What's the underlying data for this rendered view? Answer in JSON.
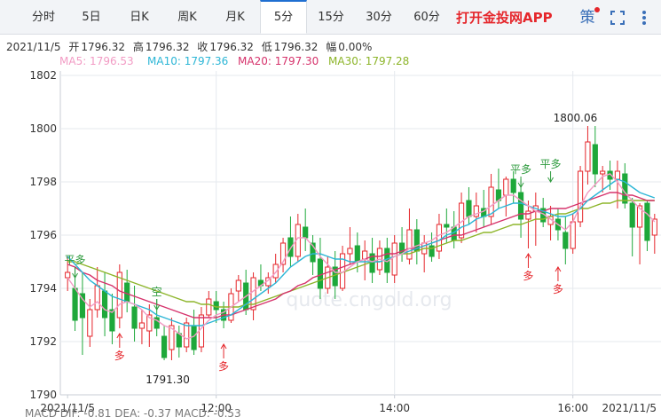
{
  "tabs": [
    {
      "label": "分时"
    },
    {
      "label": "5日"
    },
    {
      "label": "日K"
    },
    {
      "label": "周K"
    },
    {
      "label": "月K"
    },
    {
      "label": "5分",
      "active": true
    },
    {
      "label": "15分"
    },
    {
      "label": "30分"
    },
    {
      "label": "60分"
    }
  ],
  "app_link": "打开金投网APP",
  "tools": {
    "strategy": "策",
    "fullscreen_icon": "fullscreen-icon",
    "more_icon": "more-dots-icon"
  },
  "quote": {
    "date": "2021/11/5",
    "open_label": "开",
    "open": "1796.32",
    "high_label": "高",
    "high": "1796.32",
    "close_label": "收",
    "close": "1796.32",
    "low_label": "低",
    "low": "1796.32",
    "amp_label": "幅",
    "amp": "0.00%"
  },
  "ma_legend": [
    {
      "label": "MA5: 1796.53",
      "color": "#f29bc4"
    },
    {
      "label": "MA10: 1797.36",
      "color": "#2cb6d6"
    },
    {
      "label": "MA20: 1797.30",
      "color": "#d6336c"
    },
    {
      "label": "MA30: 1797.28",
      "color": "#8db52a"
    }
  ],
  "macd_legend": {
    "text": "MACD  DIF: -0.81    DEA: -0.37    MACD: -0.53"
  },
  "watermark": "quote.cngold.org",
  "colors": {
    "up": "#e5262b",
    "down": "#1ea83a",
    "grid": "#e6e9ee",
    "axis_text": "#333333",
    "signal": "#e5262b",
    "signal_flat": "#2e9b3e"
  },
  "chart_data": {
    "type": "candlestick",
    "instrument_interval": "5分",
    "ylim": [
      1790,
      1802
    ],
    "y_ticks": [
      "1790",
      "1792",
      "1794",
      "1796",
      "1798",
      "1800",
      "1802"
    ],
    "x_ticks": [
      {
        "label": "2021/11/5",
        "index": 0
      },
      {
        "label": "12:00",
        "index": 20
      },
      {
        "label": "14:00",
        "index": 44
      },
      {
        "label": "16:00",
        "index": 68
      },
      {
        "label": "2021/11/5",
        "index": 80
      }
    ],
    "candles": [
      {
        "o": 1794.4,
        "h": 1795.2,
        "l": 1793.9,
        "c": 1794.6
      },
      {
        "o": 1794.0,
        "h": 1794.8,
        "l": 1792.4,
        "c": 1792.8
      },
      {
        "o": 1793.8,
        "h": 1794.6,
        "l": 1791.5,
        "c": 1792.9
      },
      {
        "o": 1792.2,
        "h": 1793.6,
        "l": 1791.8,
        "c": 1793.2
      },
      {
        "o": 1793.2,
        "h": 1794.8,
        "l": 1792.9,
        "c": 1794.1
      },
      {
        "o": 1793.9,
        "h": 1794.6,
        "l": 1792.2,
        "c": 1792.9
      },
      {
        "o": 1793.2,
        "h": 1793.8,
        "l": 1791.9,
        "c": 1792.4
      },
      {
        "o": 1792.9,
        "h": 1794.9,
        "l": 1792.5,
        "c": 1794.6
      },
      {
        "o": 1794.2,
        "h": 1794.7,
        "l": 1793.1,
        "c": 1793.5
      },
      {
        "o": 1793.3,
        "h": 1794.1,
        "l": 1792.0,
        "c": 1792.5
      },
      {
        "o": 1792.5,
        "h": 1793.2,
        "l": 1791.9,
        "c": 1792.7
      },
      {
        "o": 1792.4,
        "h": 1793.4,
        "l": 1791.8,
        "c": 1793.0
      },
      {
        "o": 1792.9,
        "h": 1793.6,
        "l": 1792.2,
        "c": 1792.5
      },
      {
        "o": 1792.2,
        "h": 1792.6,
        "l": 1791.3,
        "c": 1791.4
      },
      {
        "o": 1791.7,
        "h": 1792.9,
        "l": 1791.3,
        "c": 1792.6
      },
      {
        "o": 1792.3,
        "h": 1792.6,
        "l": 1791.4,
        "c": 1791.8
      },
      {
        "o": 1791.8,
        "h": 1792.9,
        "l": 1791.6,
        "c": 1792.7
      },
      {
        "o": 1792.6,
        "h": 1793.2,
        "l": 1791.5,
        "c": 1791.7
      },
      {
        "o": 1791.8,
        "h": 1793.3,
        "l": 1791.6,
        "c": 1793.0
      },
      {
        "o": 1793.0,
        "h": 1793.9,
        "l": 1792.9,
        "c": 1793.6
      },
      {
        "o": 1793.5,
        "h": 1793.9,
        "l": 1792.7,
        "c": 1793.2
      },
      {
        "o": 1793.2,
        "h": 1793.5,
        "l": 1792.5,
        "c": 1792.8
      },
      {
        "o": 1792.8,
        "h": 1794.0,
        "l": 1792.7,
        "c": 1793.8
      },
      {
        "o": 1793.9,
        "h": 1794.5,
        "l": 1793.5,
        "c": 1794.3
      },
      {
        "o": 1794.2,
        "h": 1794.7,
        "l": 1793.0,
        "c": 1793.2
      },
      {
        "o": 1793.2,
        "h": 1794.6,
        "l": 1792.8,
        "c": 1794.4
      },
      {
        "o": 1794.3,
        "h": 1794.9,
        "l": 1793.9,
        "c": 1794.1
      },
      {
        "o": 1794.1,
        "h": 1794.6,
        "l": 1793.8,
        "c": 1794.4
      },
      {
        "o": 1794.4,
        "h": 1795.3,
        "l": 1794.2,
        "c": 1794.9
      },
      {
        "o": 1794.9,
        "h": 1795.9,
        "l": 1794.6,
        "c": 1795.7
      },
      {
        "o": 1795.9,
        "h": 1796.7,
        "l": 1794.8,
        "c": 1795.2
      },
      {
        "o": 1795.2,
        "h": 1796.8,
        "l": 1795.0,
        "c": 1796.4
      },
      {
        "o": 1796.3,
        "h": 1797.0,
        "l": 1795.4,
        "c": 1795.9
      },
      {
        "o": 1795.7,
        "h": 1796.0,
        "l": 1794.5,
        "c": 1795.0
      },
      {
        "o": 1795.1,
        "h": 1795.9,
        "l": 1793.6,
        "c": 1794.0
      },
      {
        "o": 1794.0,
        "h": 1795.2,
        "l": 1793.8,
        "c": 1794.8
      },
      {
        "o": 1794.8,
        "h": 1795.4,
        "l": 1793.6,
        "c": 1794.1
      },
      {
        "o": 1794.0,
        "h": 1795.6,
        "l": 1793.9,
        "c": 1795.3
      },
      {
        "o": 1795.3,
        "h": 1796.3,
        "l": 1794.9,
        "c": 1795.5
      },
      {
        "o": 1795.6,
        "h": 1796.1,
        "l": 1794.6,
        "c": 1795.0
      },
      {
        "o": 1795.1,
        "h": 1795.8,
        "l": 1794.3,
        "c": 1795.4
      },
      {
        "o": 1795.3,
        "h": 1795.9,
        "l": 1794.2,
        "c": 1794.6
      },
      {
        "o": 1794.7,
        "h": 1795.8,
        "l": 1794.5,
        "c": 1795.5
      },
      {
        "o": 1795.5,
        "h": 1795.9,
        "l": 1794.2,
        "c": 1794.6
      },
      {
        "o": 1794.5,
        "h": 1796.0,
        "l": 1794.2,
        "c": 1795.7
      },
      {
        "o": 1795.7,
        "h": 1796.3,
        "l": 1795.0,
        "c": 1795.3
      },
      {
        "o": 1795.1,
        "h": 1797.0,
        "l": 1794.9,
        "c": 1796.2
      },
      {
        "o": 1796.2,
        "h": 1796.6,
        "l": 1794.9,
        "c": 1795.4
      },
      {
        "o": 1795.3,
        "h": 1796.0,
        "l": 1794.6,
        "c": 1795.7
      },
      {
        "o": 1795.6,
        "h": 1796.1,
        "l": 1795.0,
        "c": 1795.2
      },
      {
        "o": 1795.4,
        "h": 1796.8,
        "l": 1795.1,
        "c": 1796.4
      },
      {
        "o": 1796.4,
        "h": 1797.0,
        "l": 1795.7,
        "c": 1796.3
      },
      {
        "o": 1796.3,
        "h": 1796.9,
        "l": 1795.5,
        "c": 1795.8
      },
      {
        "o": 1795.9,
        "h": 1797.6,
        "l": 1795.7,
        "c": 1797.2
      },
      {
        "o": 1797.3,
        "h": 1797.8,
        "l": 1796.4,
        "c": 1796.7
      },
      {
        "o": 1796.7,
        "h": 1797.6,
        "l": 1796.1,
        "c": 1797.1
      },
      {
        "o": 1797.0,
        "h": 1797.7,
        "l": 1796.3,
        "c": 1796.7
      },
      {
        "o": 1796.7,
        "h": 1798.3,
        "l": 1796.4,
        "c": 1797.8
      },
      {
        "o": 1797.7,
        "h": 1798.5,
        "l": 1797.0,
        "c": 1797.3
      },
      {
        "o": 1797.5,
        "h": 1798.2,
        "l": 1796.7,
        "c": 1798.1
      },
      {
        "o": 1798.1,
        "h": 1798.4,
        "l": 1797.2,
        "c": 1797.6
      },
      {
        "o": 1797.6,
        "h": 1798.1,
        "l": 1795.9,
        "c": 1796.6
      },
      {
        "o": 1796.6,
        "h": 1797.3,
        "l": 1795.5,
        "c": 1796.9
      },
      {
        "o": 1796.9,
        "h": 1797.6,
        "l": 1795.6,
        "c": 1797.1
      },
      {
        "o": 1797.0,
        "h": 1797.4,
        "l": 1796.3,
        "c": 1796.5
      },
      {
        "o": 1796.4,
        "h": 1797.1,
        "l": 1795.8,
        "c": 1796.7
      },
      {
        "o": 1796.6,
        "h": 1797.0,
        "l": 1795.8,
        "c": 1796.2
      },
      {
        "o": 1796.1,
        "h": 1796.7,
        "l": 1794.9,
        "c": 1795.5
      },
      {
        "o": 1795.5,
        "h": 1796.8,
        "l": 1795.3,
        "c": 1796.5
      },
      {
        "o": 1796.5,
        "h": 1798.6,
        "l": 1796.3,
        "c": 1798.4
      },
      {
        "o": 1798.4,
        "h": 1800.1,
        "l": 1797.9,
        "c": 1799.5
      },
      {
        "o": 1799.4,
        "h": 1800.1,
        "l": 1797.8,
        "c": 1798.3
      },
      {
        "o": 1798.3,
        "h": 1798.6,
        "l": 1797.6,
        "c": 1798.4
      },
      {
        "o": 1798.4,
        "h": 1798.8,
        "l": 1797.7,
        "c": 1798.1
      },
      {
        "o": 1798.1,
        "h": 1798.8,
        "l": 1797.0,
        "c": 1798.4
      },
      {
        "o": 1798.3,
        "h": 1798.7,
        "l": 1797.0,
        "c": 1797.2
      },
      {
        "o": 1797.2,
        "h": 1797.4,
        "l": 1795.2,
        "c": 1796.3
      },
      {
        "o": 1796.3,
        "h": 1797.2,
        "l": 1794.9,
        "c": 1797.1
      },
      {
        "o": 1797.2,
        "h": 1797.3,
        "l": 1795.4,
        "c": 1795.8
      },
      {
        "o": 1796.0,
        "h": 1796.8,
        "l": 1795.3,
        "c": 1796.6
      }
    ],
    "ma5": [
      1794.4,
      1794.0,
      1793.6,
      1793.3,
      1793.5,
      1793.2,
      1793.1,
      1793.4,
      1793.5,
      1793.4,
      1793.2,
      1792.9,
      1792.8,
      1792.6,
      1792.5,
      1792.3,
      1792.1,
      1792.2,
      1792.5,
      1792.8,
      1793.0,
      1793.1,
      1793.3,
      1793.5,
      1793.7,
      1793.9,
      1794.1,
      1794.3,
      1794.6,
      1795.0,
      1795.5,
      1795.9,
      1795.9,
      1795.6,
      1795.2,
      1794.9,
      1794.6,
      1794.6,
      1794.8,
      1795.0,
      1795.1,
      1795.0,
      1795.1,
      1795.0,
      1795.2,
      1795.3,
      1795.5,
      1795.6,
      1795.7,
      1795.8,
      1796.0,
      1796.1,
      1796.3,
      1796.5,
      1796.7,
      1796.8,
      1796.9,
      1797.1,
      1797.3,
      1797.5,
      1797.5,
      1797.3,
      1797.1,
      1796.9,
      1796.8,
      1796.6,
      1796.4,
      1796.2,
      1796.5,
      1797.1,
      1797.6,
      1797.9,
      1798.2,
      1798.3,
      1798.0,
      1797.6,
      1797.3,
      1797.0,
      1796.8,
      1796.5
    ],
    "ma10": [
      1795.2,
      1794.9,
      1794.6,
      1794.3,
      1794.1,
      1793.9,
      1793.7,
      1793.6,
      1793.5,
      1793.4,
      1793.3,
      1793.2,
      1793.0,
      1792.9,
      1792.8,
      1792.7,
      1792.6,
      1792.6,
      1792.6,
      1792.7,
      1792.8,
      1792.9,
      1793.0,
      1793.2,
      1793.4,
      1793.6,
      1793.8,
      1794.0,
      1794.2,
      1794.5,
      1794.8,
      1795.0,
      1795.2,
      1795.3,
      1795.3,
      1795.2,
      1795.1,
      1795.1,
      1795.0,
      1795.0,
      1795.0,
      1795.0,
      1795.0,
      1795.1,
      1795.2,
      1795.3,
      1795.4,
      1795.5,
      1795.6,
      1795.7,
      1795.8,
      1796.0,
      1796.1,
      1796.3,
      1796.4,
      1796.6,
      1796.7,
      1796.8,
      1797.0,
      1797.1,
      1797.2,
      1797.2,
      1797.1,
      1797.0,
      1796.9,
      1796.8,
      1796.7,
      1796.7,
      1796.8,
      1797.0,
      1797.3,
      1797.5,
      1797.7,
      1797.9,
      1798.1,
      1798.0,
      1797.8,
      1797.6,
      1797.5,
      1797.4
    ],
    "ma20": [
      1794.9,
      1794.8,
      1794.6,
      1794.5,
      1794.3,
      1794.2,
      1794.1,
      1793.9,
      1793.8,
      1793.7,
      1793.6,
      1793.5,
      1793.4,
      1793.3,
      1793.2,
      1793.1,
      1793.0,
      1792.9,
      1792.9,
      1792.9,
      1792.9,
      1793.0,
      1793.0,
      1793.1,
      1793.2,
      1793.3,
      1793.4,
      1793.5,
      1793.6,
      1793.8,
      1793.9,
      1794.1,
      1794.2,
      1794.4,
      1794.5,
      1794.6,
      1794.7,
      1794.8,
      1794.9,
      1795.0,
      1795.1,
      1795.2,
      1795.2,
      1795.3,
      1795.3,
      1795.4,
      1795.5,
      1795.5,
      1795.6,
      1795.7,
      1795.8,
      1795.9,
      1796.0,
      1796.0,
      1796.1,
      1796.2,
      1796.3,
      1796.4,
      1796.5,
      1796.6,
      1796.7,
      1796.8,
      1796.8,
      1796.9,
      1796.9,
      1797.0,
      1797.0,
      1797.0,
      1797.1,
      1797.2,
      1797.3,
      1797.4,
      1797.5,
      1797.6,
      1797.6,
      1797.5,
      1797.5,
      1797.4,
      1797.3,
      1797.3
    ],
    "ma30": [
      1795.0,
      1795.0,
      1794.9,
      1794.8,
      1794.7,
      1794.6,
      1794.5,
      1794.4,
      1794.3,
      1794.2,
      1794.1,
      1794.0,
      1793.9,
      1793.8,
      1793.7,
      1793.6,
      1793.5,
      1793.5,
      1793.4,
      1793.4,
      1793.3,
      1793.3,
      1793.3,
      1793.3,
      1793.4,
      1793.4,
      1793.5,
      1793.6,
      1793.7,
      1793.8,
      1793.9,
      1794.0,
      1794.1,
      1794.2,
      1794.3,
      1794.4,
      1794.5,
      1794.6,
      1794.7,
      1794.8,
      1794.9,
      1795.0,
      1795.0,
      1795.1,
      1795.2,
      1795.3,
      1795.3,
      1795.4,
      1795.5,
      1795.5,
      1795.6,
      1795.7,
      1795.8,
      1795.8,
      1795.9,
      1796.0,
      1796.1,
      1796.1,
      1796.2,
      1796.3,
      1796.4,
      1796.4,
      1796.5,
      1796.6,
      1796.6,
      1796.7,
      1796.8,
      1796.8,
      1796.9,
      1797.0,
      1797.0,
      1797.1,
      1797.2,
      1797.2,
      1797.3,
      1797.3,
      1797.3,
      1797.3,
      1797.3,
      1797.3
    ],
    "annotations": [
      {
        "text": "1800.06",
        "type": "high_label",
        "index": 70,
        "y": 1800.06
      },
      {
        "text": "1791.30",
        "type": "low_label",
        "index": 13,
        "y": 1791.3
      }
    ],
    "signals": [
      {
        "text": "平多",
        "index": 1,
        "y": 1794.6,
        "dir": "flat"
      },
      {
        "text": "多",
        "index": 7,
        "y": 1792.3,
        "dir": "up"
      },
      {
        "text": "空",
        "index": 12,
        "y": 1793.4,
        "dir": "flat"
      },
      {
        "text": "多",
        "index": 21,
        "y": 1791.9,
        "dir": "up"
      },
      {
        "text": "平多",
        "index": 61,
        "y": 1798.0,
        "dir": "flat"
      },
      {
        "text": "平多",
        "index": 65,
        "y": 1798.2,
        "dir": "flat"
      },
      {
        "text": "多",
        "index": 62,
        "y": 1795.3,
        "dir": "up"
      },
      {
        "text": "多",
        "index": 66,
        "y": 1794.8,
        "dir": "up"
      }
    ]
  }
}
